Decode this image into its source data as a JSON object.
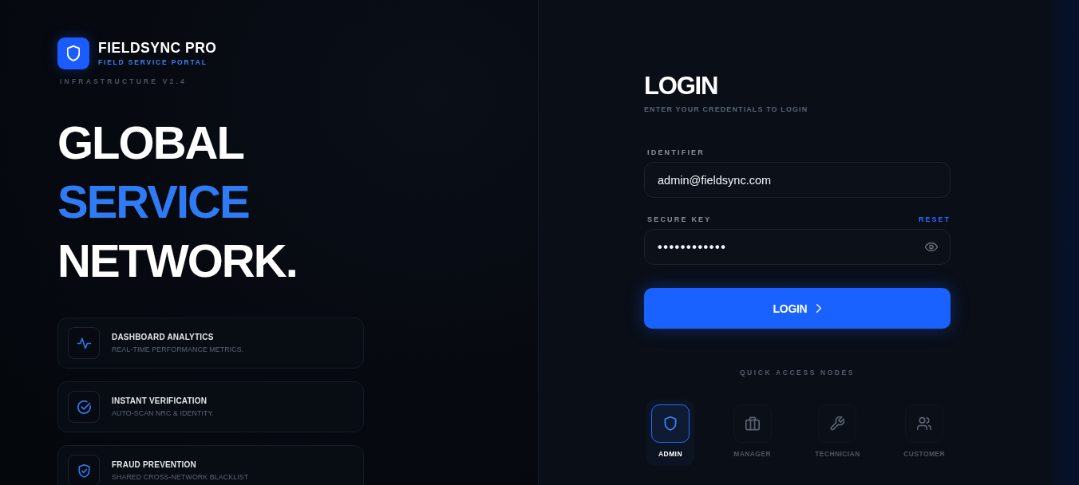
{
  "brand": {
    "name": "FIELDSYNC PRO",
    "tagline": "FIELD SERVICE PORTAL",
    "version": "INFRASTRUCTURE V2.4"
  },
  "headline": [
    {
      "text": "GLOBAL",
      "accent": false
    },
    {
      "text": "SERVICE",
      "accent": true
    },
    {
      "text": "NETWORK.",
      "accent": false
    }
  ],
  "features": [
    {
      "title": "DASHBOARD ANALYTICS",
      "description": "REAL-TIME PERFORMANCE METRICS."
    },
    {
      "title": "INSTANT VERIFICATION",
      "description": "AUTO-SCAN NRC & IDENTITY."
    },
    {
      "title": "FRAUD PREVENTION",
      "description": "SHARED CROSS-NETWORK BLACKLIST"
    }
  ],
  "login": {
    "title": "LOGIN",
    "subtitle": "ENTER YOUR CREDENTIALS TO LOGIN",
    "fields": [
      {
        "kind": "text",
        "label": "IDENTIFIER",
        "value": "admin@fieldsync.com"
      },
      {
        "kind": "password",
        "label": "SECURE KEY",
        "link": "RESET",
        "value": "••••••••••••"
      }
    ],
    "submit": "LOGIN",
    "quick_access": {
      "title": "QUICK ACCESS NODES",
      "nodes": [
        {
          "label": "ADMIN",
          "selected": true
        },
        {
          "label": "MANAGER",
          "selected": false
        },
        {
          "label": "TECHNICIAN",
          "selected": false
        },
        {
          "label": "CUSTOMER",
          "selected": false
        }
      ]
    }
  }
}
